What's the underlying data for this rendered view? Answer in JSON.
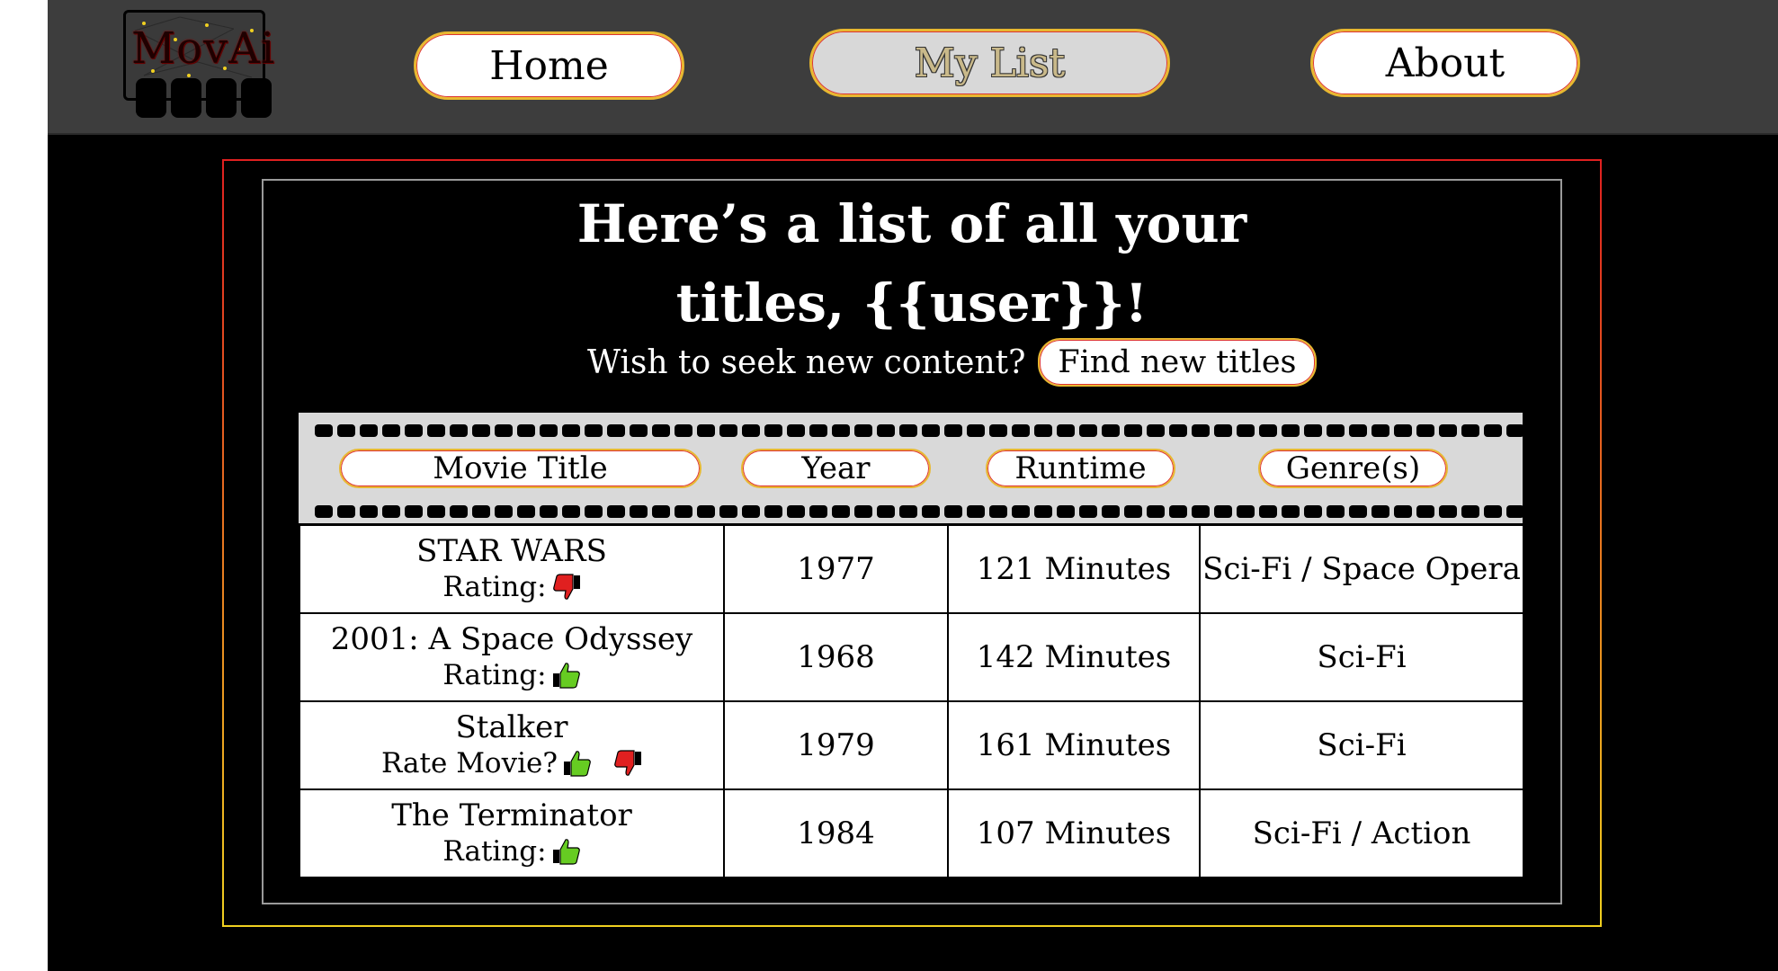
{
  "nav": {
    "logo_text": "MovAi",
    "home_label": "Home",
    "mylist_label": "My List",
    "about_label": "About"
  },
  "main": {
    "heading_line1": "Here’s a list of all your",
    "heading_line2": "titles, {{user}}!",
    "prompt_text": "Wish to seek new content?",
    "find_button_label": "Find new titles"
  },
  "table": {
    "columns": [
      "Movie Title",
      "Year",
      "Runtime",
      "Genre(s)"
    ],
    "rows": [
      {
        "title": "STAR WARS",
        "rating_label": "Rating:",
        "rating": "thumbs-down",
        "year": "1977",
        "runtime": "121 Minutes",
        "genre": "Sci-Fi / Space Opera"
      },
      {
        "title": "2001: A Space Odyssey",
        "rating_label": "Rating:",
        "rating": "thumbs-up",
        "year": "1968",
        "runtime": "142 Minutes",
        "genre": "Sci-Fi"
      },
      {
        "title": "Stalker",
        "rating_label": "Rate Movie?",
        "rating": "unrated",
        "year": "1979",
        "runtime": "161 Minutes",
        "genre": "Sci-Fi"
      },
      {
        "title": "The Terminator",
        "rating_label": "Rating:",
        "rating": "thumbs-up",
        "year": "1984",
        "runtime": "107 Minutes",
        "genre": "Sci-Fi / Action"
      }
    ]
  },
  "colors": {
    "thumb_up": "#66cc22",
    "thumb_down": "#e02020",
    "accent_gold": "#e8b830",
    "accent_red": "#e02020"
  }
}
